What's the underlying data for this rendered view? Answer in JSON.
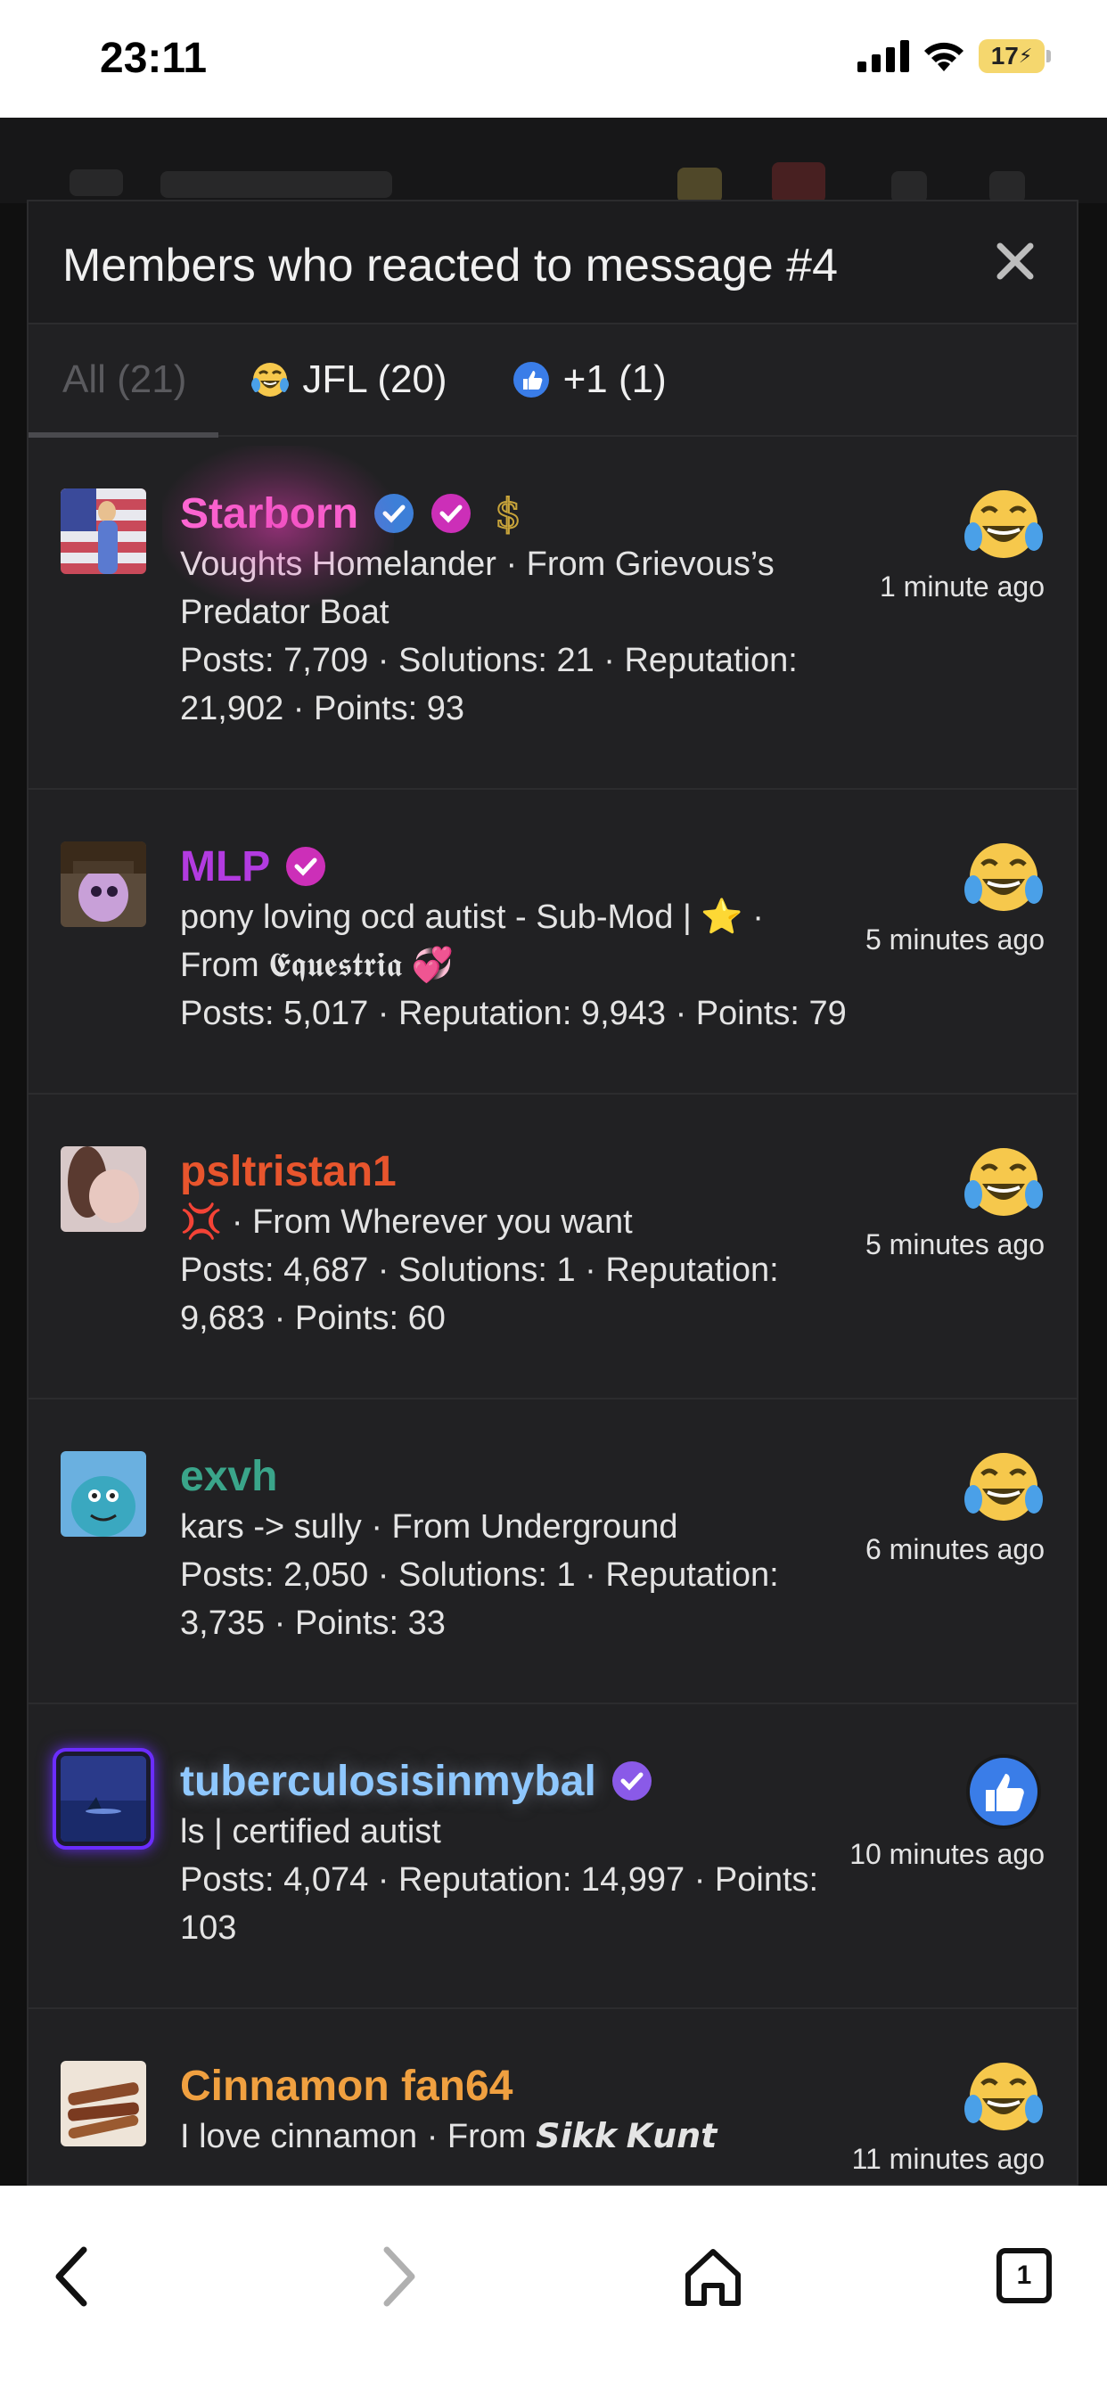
{
  "status_bar": {
    "time": "23:11",
    "battery": "17"
  },
  "modal": {
    "title": "Members who reacted to message #4",
    "tabs": [
      {
        "label": "All (21)",
        "active": true
      },
      {
        "label": "JFL (20)",
        "icon": "laughing-crying-emoji-icon"
      },
      {
        "label": "+1 (1)",
        "icon": "thumbs-up-icon"
      }
    ]
  },
  "members": [
    {
      "name": "Starborn",
      "name_color": "#ff6ad5",
      "title_line": "Voughts Homelander · From Grievous’s Predator Boat",
      "stats": "Posts: 7,709 · Solutions: 21 · Reputation: 21,902 · Points: 93",
      "reaction": "laughing-crying-emoji-icon",
      "time": "1 minute ago"
    },
    {
      "name": "MLP",
      "name_color": "#b23be0",
      "title_line": "pony loving ocd autist - Sub-Mod | ⭐ ·",
      "title_line2": "From 𝕰𝖖𝖚𝖊𝖘𝖙𝖗𝖎𝖆 💞",
      "stats": "Posts: 5,017 · Reputation: 9,943 · Points: 79",
      "reaction": "laughing-crying-emoji-icon",
      "time": "5 minutes ago"
    },
    {
      "name": "psltristan1",
      "name_color": "#e8552d",
      "title_line": "💢 · From Wherever you want",
      "stats": "Posts: 4,687 · Solutions: 1 · Reputation: 9,683 · Points: 60",
      "reaction": "laughing-crying-emoji-icon",
      "time": "5 minutes ago"
    },
    {
      "name": "exvh",
      "name_color": "#3aa58a",
      "title_line": "kars -> sully · From Underground",
      "stats": "Posts: 2,050 · Solutions: 1 · Reputation: 3,735 · Points: 33",
      "reaction": "laughing-crying-emoji-icon",
      "time": "6 minutes ago"
    },
    {
      "name": "tuberculosisinmybal",
      "name_color": "#8fc8ff",
      "title_line": "ls | certified autist",
      "stats": "Posts: 4,074 · Reputation: 14,997 · Points: 103",
      "reaction": "thumbs-up-icon",
      "time": "10 minutes ago"
    },
    {
      "name": "Cinnamon fan64",
      "name_color": "#f0a040",
      "title_line": "I love cinnamon · From 𝙎𝙞𝙠𝙠 𝙆𝙪𝙣𝙩",
      "stats": "",
      "reaction": "laughing-crying-emoji-icon",
      "time": "11 minutes ago"
    }
  ],
  "bottom_bar": {
    "tab_count": "1"
  }
}
